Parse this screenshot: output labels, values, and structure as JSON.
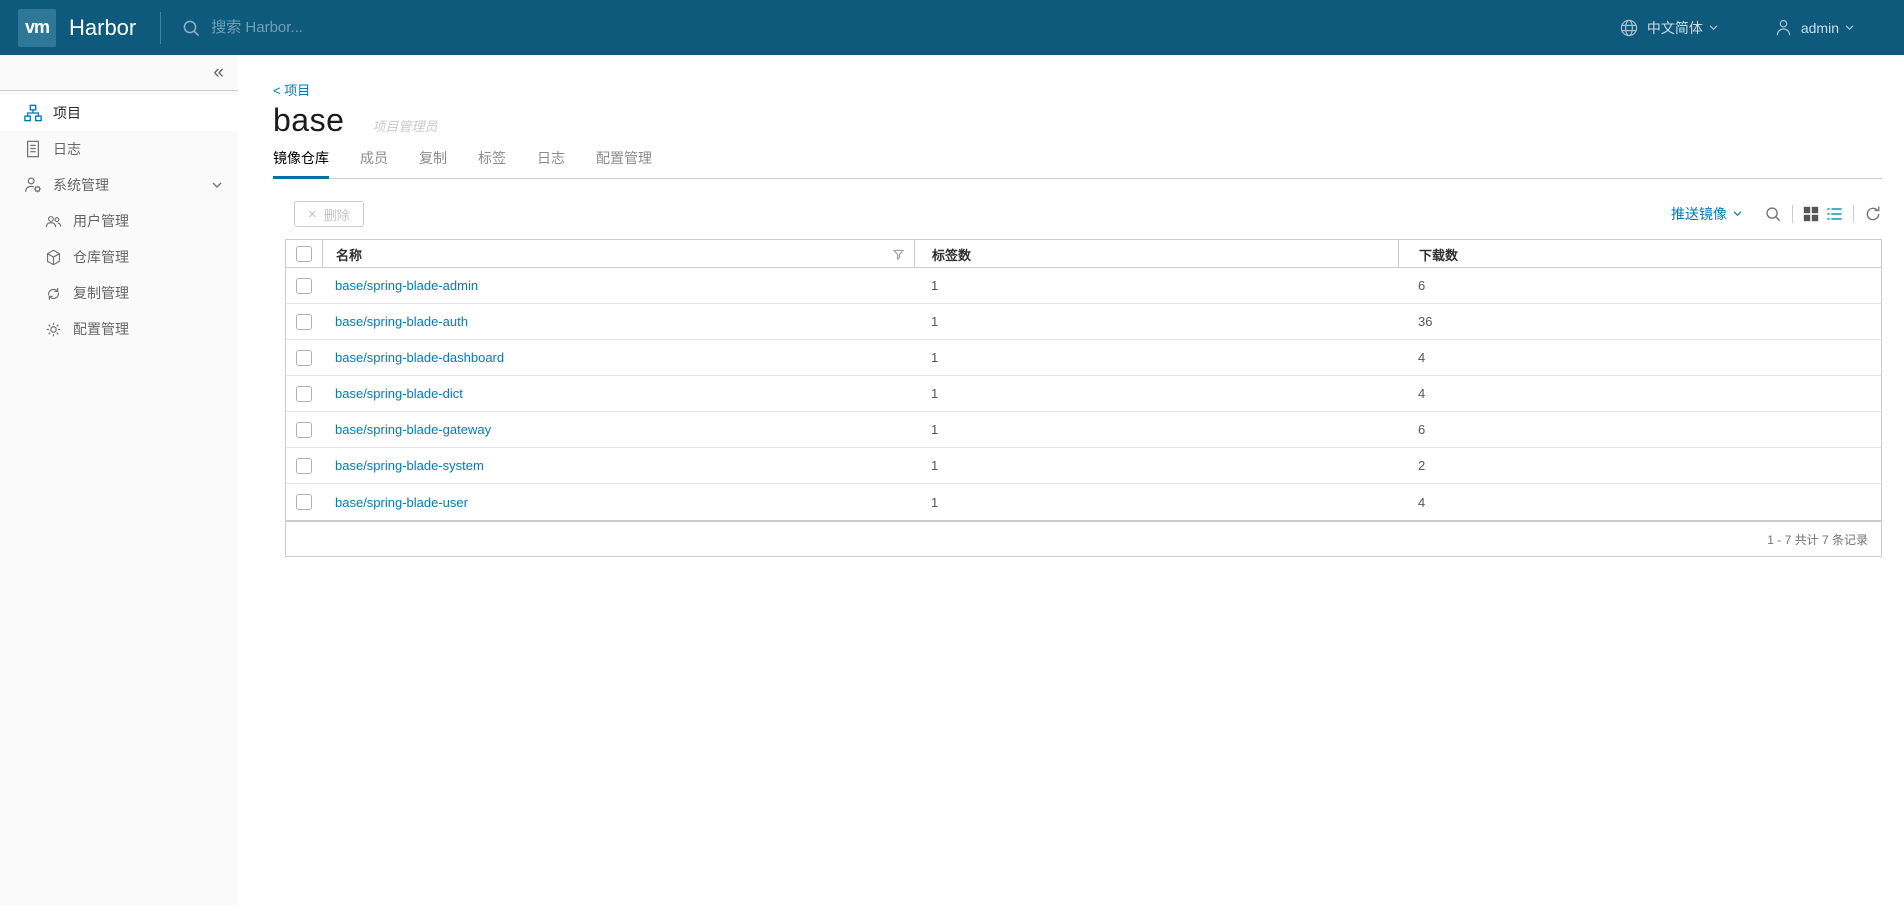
{
  "header": {
    "logo_text": "vm",
    "app_name": "Harbor",
    "search_placeholder": "搜索 Harbor...",
    "language": "中文简体",
    "username": "admin"
  },
  "sidebar": {
    "collapse_glyph": "«",
    "items": [
      {
        "label": "项目"
      },
      {
        "label": "日志"
      },
      {
        "label": "系统管理"
      }
    ],
    "subitems": [
      {
        "label": "用户管理"
      },
      {
        "label": "仓库管理"
      },
      {
        "label": "复制管理"
      },
      {
        "label": "配置管理"
      }
    ]
  },
  "main": {
    "back_link": "< 项目",
    "title": "base",
    "role_badge": "项目管理员",
    "tabs": [
      {
        "label": "镜像仓库"
      },
      {
        "label": "成员"
      },
      {
        "label": "复制"
      },
      {
        "label": "标签"
      },
      {
        "label": "日志"
      },
      {
        "label": "配置管理"
      }
    ],
    "toolbar": {
      "delete_glyph": "×",
      "delete_label": "删除",
      "push_image_label": "推送镜像"
    },
    "table": {
      "columns": {
        "name": "名称",
        "tags": "标签数",
        "downloads": "下载数"
      },
      "rows": [
        {
          "name": "base/spring-blade-admin",
          "tags": "1",
          "downloads": "6"
        },
        {
          "name": "base/spring-blade-auth",
          "tags": "1",
          "downloads": "36"
        },
        {
          "name": "base/spring-blade-dashboard",
          "tags": "1",
          "downloads": "4"
        },
        {
          "name": "base/spring-blade-dict",
          "tags": "1",
          "downloads": "4"
        },
        {
          "name": "base/spring-blade-gateway",
          "tags": "1",
          "downloads": "6"
        },
        {
          "name": "base/spring-blade-system",
          "tags": "1",
          "downloads": "2"
        },
        {
          "name": "base/spring-blade-user",
          "tags": "1",
          "downloads": "4"
        }
      ],
      "footer_text": "1 - 7 共计 7 条记录"
    }
  },
  "colors": {
    "header_bg": "#0d5a7d",
    "link_blue": "#007cbb",
    "active_tab_underline": "#0072a3",
    "active_list_icon": "#49afd9"
  }
}
